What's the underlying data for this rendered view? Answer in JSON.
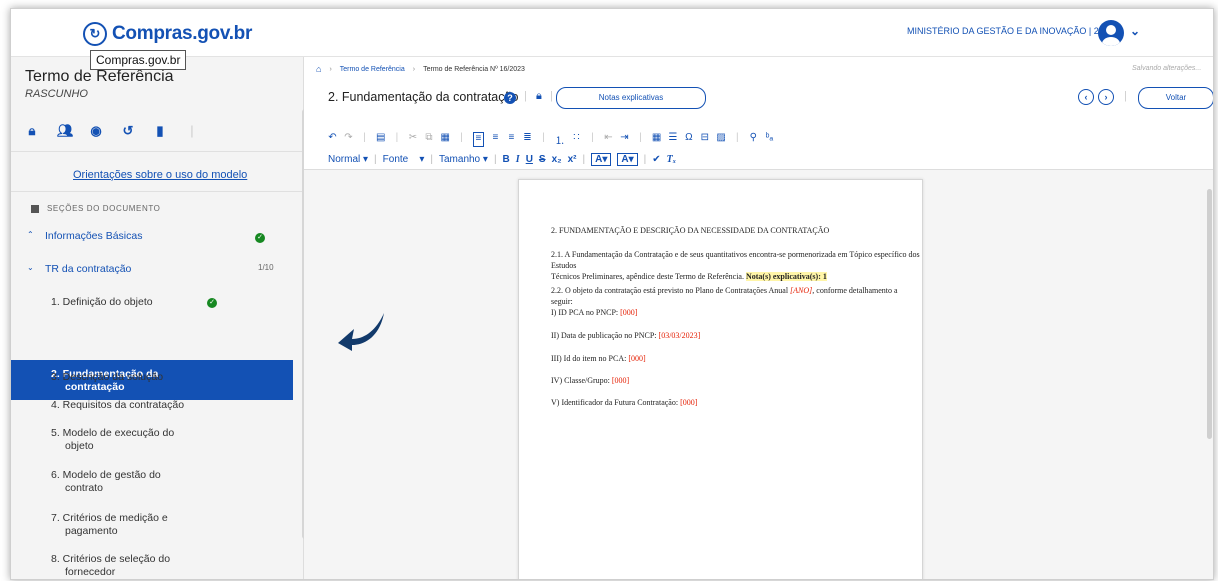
{
  "header": {
    "logo_text": "Compras.gov.br",
    "tooltip": "Compras.gov.br",
    "ministry": "MINISTÉRIO DA GESTÃO E DA INOVAÇÃO | 200999"
  },
  "sidebar": {
    "title": "Termo de Referência",
    "status": "RASCUNHO",
    "tools": [
      "lock-icon",
      "users-icon",
      "eye-icon",
      "history-icon",
      "document-icon"
    ],
    "guide_link": "Orientações sobre o uso do modelo",
    "section_label": "SEÇÕES DO DOCUMENTO",
    "groups": [
      {
        "label": "Informações Básicas",
        "complete": true
      },
      {
        "label": "TR da contratação",
        "count": "1/10"
      }
    ],
    "items": [
      {
        "label": "1. Definição do objeto",
        "complete": true
      },
      {
        "label_line1": "2. Fundamentação da",
        "label_line2": "contratação",
        "active": true
      },
      {
        "label": "3. Descrição da solução"
      },
      {
        "label": "4. Requisitos da contratação"
      },
      {
        "label_line1": "5. Modelo de execução do",
        "label_line2": "objeto"
      },
      {
        "label_line1": "6. Modelo de gestão do",
        "label_line2": "contrato"
      },
      {
        "label_line1": "7. Critérios de medição e",
        "label_line2": "pagamento"
      },
      {
        "label_line1": "8. Critérios de seleção do",
        "label_line2": "fornecedor"
      }
    ]
  },
  "breadcrumb": {
    "item1": "Termo de Referência",
    "item2": "Termo de Referência Nº 16/2023"
  },
  "saving_status": "Salvando alterações...",
  "section_title": "2. Fundamentação da contratação",
  "notes_button": "Notas explicativas",
  "back_button": "Voltar",
  "editor": {
    "format_select": "Normal",
    "font_select": "Fonte",
    "size_select": "Tamanho"
  },
  "document": {
    "heading": "2. FUNDAMENTAÇÃO E DESCRIÇÃO DA NECESSIDADE DA CONTRATAÇÃO",
    "p1_a": "2.1. A Fundamentação da Contratação e de seus quantitativos encontra-se pormenorizada em Tópico específico dos Estudos",
    "p1_b": "Técnicos Preliminares, apêndice deste Termo de Referência.",
    "p1_note": "Nota(s) explicativa(s): 1",
    "p2_a": "2.2. O objeto da contratação está previsto no Plano de Contratações Anual",
    "p2_placeholder": "[ANO]",
    "p2_b": ", conforme detalhamento a seguir:",
    "lines": [
      {
        "label": "I) ID PCA no PNCP:",
        "value": "[000]"
      },
      {
        "label": "II) Data de publicação no PNCP:",
        "value": "[03/03/2023]"
      },
      {
        "label": "III) Id do item no PCA:",
        "value": "[000]"
      },
      {
        "label": "IV) Classe/Grupo:",
        "value": "[000]"
      },
      {
        "label": "V) Identificador da Futura Contratação:",
        "value": "[000]"
      }
    ]
  },
  "colors": {
    "primary": "#1351b4",
    "success": "#168821",
    "placeholder_red": "#e52207"
  }
}
